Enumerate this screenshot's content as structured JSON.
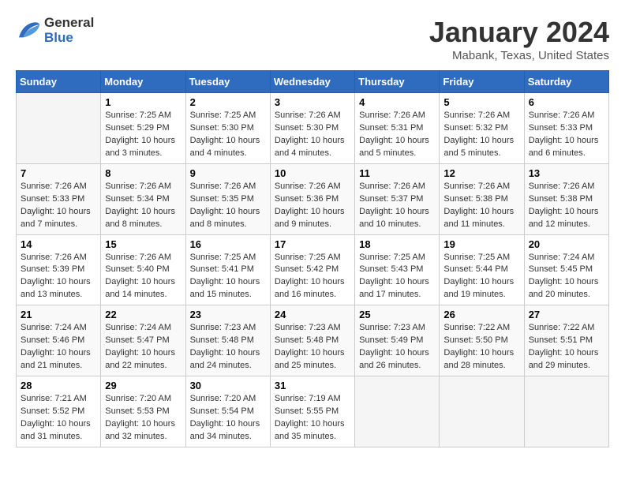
{
  "header": {
    "logo_line1": "General",
    "logo_line2": "Blue",
    "title": "January 2024",
    "location": "Mabank, Texas, United States"
  },
  "columns": [
    "Sunday",
    "Monday",
    "Tuesday",
    "Wednesday",
    "Thursday",
    "Friday",
    "Saturday"
  ],
  "weeks": [
    [
      {
        "day": "",
        "info": ""
      },
      {
        "day": "1",
        "info": "Sunrise: 7:25 AM\nSunset: 5:29 PM\nDaylight: 10 hours\nand 3 minutes."
      },
      {
        "day": "2",
        "info": "Sunrise: 7:25 AM\nSunset: 5:30 PM\nDaylight: 10 hours\nand 4 minutes."
      },
      {
        "day": "3",
        "info": "Sunrise: 7:26 AM\nSunset: 5:30 PM\nDaylight: 10 hours\nand 4 minutes."
      },
      {
        "day": "4",
        "info": "Sunrise: 7:26 AM\nSunset: 5:31 PM\nDaylight: 10 hours\nand 5 minutes."
      },
      {
        "day": "5",
        "info": "Sunrise: 7:26 AM\nSunset: 5:32 PM\nDaylight: 10 hours\nand 5 minutes."
      },
      {
        "day": "6",
        "info": "Sunrise: 7:26 AM\nSunset: 5:33 PM\nDaylight: 10 hours\nand 6 minutes."
      }
    ],
    [
      {
        "day": "7",
        "info": "Sunrise: 7:26 AM\nSunset: 5:33 PM\nDaylight: 10 hours\nand 7 minutes."
      },
      {
        "day": "8",
        "info": "Sunrise: 7:26 AM\nSunset: 5:34 PM\nDaylight: 10 hours\nand 8 minutes."
      },
      {
        "day": "9",
        "info": "Sunrise: 7:26 AM\nSunset: 5:35 PM\nDaylight: 10 hours\nand 8 minutes."
      },
      {
        "day": "10",
        "info": "Sunrise: 7:26 AM\nSunset: 5:36 PM\nDaylight: 10 hours\nand 9 minutes."
      },
      {
        "day": "11",
        "info": "Sunrise: 7:26 AM\nSunset: 5:37 PM\nDaylight: 10 hours\nand 10 minutes."
      },
      {
        "day": "12",
        "info": "Sunrise: 7:26 AM\nSunset: 5:38 PM\nDaylight: 10 hours\nand 11 minutes."
      },
      {
        "day": "13",
        "info": "Sunrise: 7:26 AM\nSunset: 5:38 PM\nDaylight: 10 hours\nand 12 minutes."
      }
    ],
    [
      {
        "day": "14",
        "info": "Sunrise: 7:26 AM\nSunset: 5:39 PM\nDaylight: 10 hours\nand 13 minutes."
      },
      {
        "day": "15",
        "info": "Sunrise: 7:26 AM\nSunset: 5:40 PM\nDaylight: 10 hours\nand 14 minutes."
      },
      {
        "day": "16",
        "info": "Sunrise: 7:25 AM\nSunset: 5:41 PM\nDaylight: 10 hours\nand 15 minutes."
      },
      {
        "day": "17",
        "info": "Sunrise: 7:25 AM\nSunset: 5:42 PM\nDaylight: 10 hours\nand 16 minutes."
      },
      {
        "day": "18",
        "info": "Sunrise: 7:25 AM\nSunset: 5:43 PM\nDaylight: 10 hours\nand 17 minutes."
      },
      {
        "day": "19",
        "info": "Sunrise: 7:25 AM\nSunset: 5:44 PM\nDaylight: 10 hours\nand 19 minutes."
      },
      {
        "day": "20",
        "info": "Sunrise: 7:24 AM\nSunset: 5:45 PM\nDaylight: 10 hours\nand 20 minutes."
      }
    ],
    [
      {
        "day": "21",
        "info": "Sunrise: 7:24 AM\nSunset: 5:46 PM\nDaylight: 10 hours\nand 21 minutes."
      },
      {
        "day": "22",
        "info": "Sunrise: 7:24 AM\nSunset: 5:47 PM\nDaylight: 10 hours\nand 22 minutes."
      },
      {
        "day": "23",
        "info": "Sunrise: 7:23 AM\nSunset: 5:48 PM\nDaylight: 10 hours\nand 24 minutes."
      },
      {
        "day": "24",
        "info": "Sunrise: 7:23 AM\nSunset: 5:48 PM\nDaylight: 10 hours\nand 25 minutes."
      },
      {
        "day": "25",
        "info": "Sunrise: 7:23 AM\nSunset: 5:49 PM\nDaylight: 10 hours\nand 26 minutes."
      },
      {
        "day": "26",
        "info": "Sunrise: 7:22 AM\nSunset: 5:50 PM\nDaylight: 10 hours\nand 28 minutes."
      },
      {
        "day": "27",
        "info": "Sunrise: 7:22 AM\nSunset: 5:51 PM\nDaylight: 10 hours\nand 29 minutes."
      }
    ],
    [
      {
        "day": "28",
        "info": "Sunrise: 7:21 AM\nSunset: 5:52 PM\nDaylight: 10 hours\nand 31 minutes."
      },
      {
        "day": "29",
        "info": "Sunrise: 7:20 AM\nSunset: 5:53 PM\nDaylight: 10 hours\nand 32 minutes."
      },
      {
        "day": "30",
        "info": "Sunrise: 7:20 AM\nSunset: 5:54 PM\nDaylight: 10 hours\nand 34 minutes."
      },
      {
        "day": "31",
        "info": "Sunrise: 7:19 AM\nSunset: 5:55 PM\nDaylight: 10 hours\nand 35 minutes."
      },
      {
        "day": "",
        "info": ""
      },
      {
        "day": "",
        "info": ""
      },
      {
        "day": "",
        "info": ""
      }
    ]
  ]
}
